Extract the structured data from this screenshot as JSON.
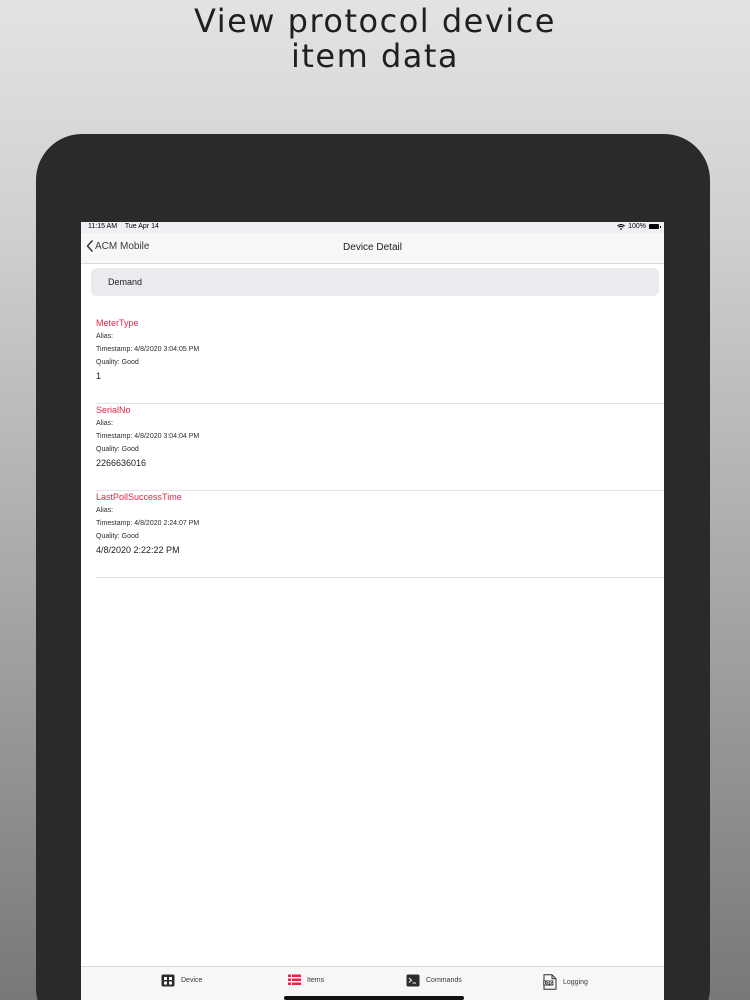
{
  "headline": {
    "line1": "View protocol device",
    "line2": "item data"
  },
  "status_bar": {
    "time": "11:15 AM",
    "date": "Tue Apr 14",
    "battery": "100%",
    "icons": [
      "wifi-icon",
      "battery-icon"
    ]
  },
  "nav": {
    "back_label": "ACM Mobile",
    "title": "Device Detail",
    "back_icon": "chevron-left-icon"
  },
  "section": {
    "title": "Demand"
  },
  "items": [
    {
      "name": "MeterType",
      "alias": "Alias:",
      "timestamp": "Timestamp: 4/8/2020 3:04:05 PM",
      "quality": "Quality: Good",
      "value": "1"
    },
    {
      "name": "SerialNo",
      "alias": "Alias:",
      "timestamp": "Timestamp: 4/8/2020 3:04:04 PM",
      "quality": "Quality: Good",
      "value": "2266636016"
    },
    {
      "name": "LastPollSuccessTime",
      "alias": "Alias:",
      "timestamp": "Timestamp: 4/8/2020 2:24:07 PM",
      "quality": "Quality: Good",
      "value": "4/8/2020 2:22:22 PM"
    }
  ],
  "tabs": [
    {
      "label": "Device",
      "icon": "device-grid-icon"
    },
    {
      "label": "Items",
      "icon": "items-list-icon",
      "active": true
    },
    {
      "label": "Commands",
      "icon": "terminal-icon"
    },
    {
      "label": "Logging",
      "icon": "log-file-icon"
    }
  ],
  "colors": {
    "accent": "#e2264a",
    "tablet_bezel": "#2a2a2b"
  }
}
